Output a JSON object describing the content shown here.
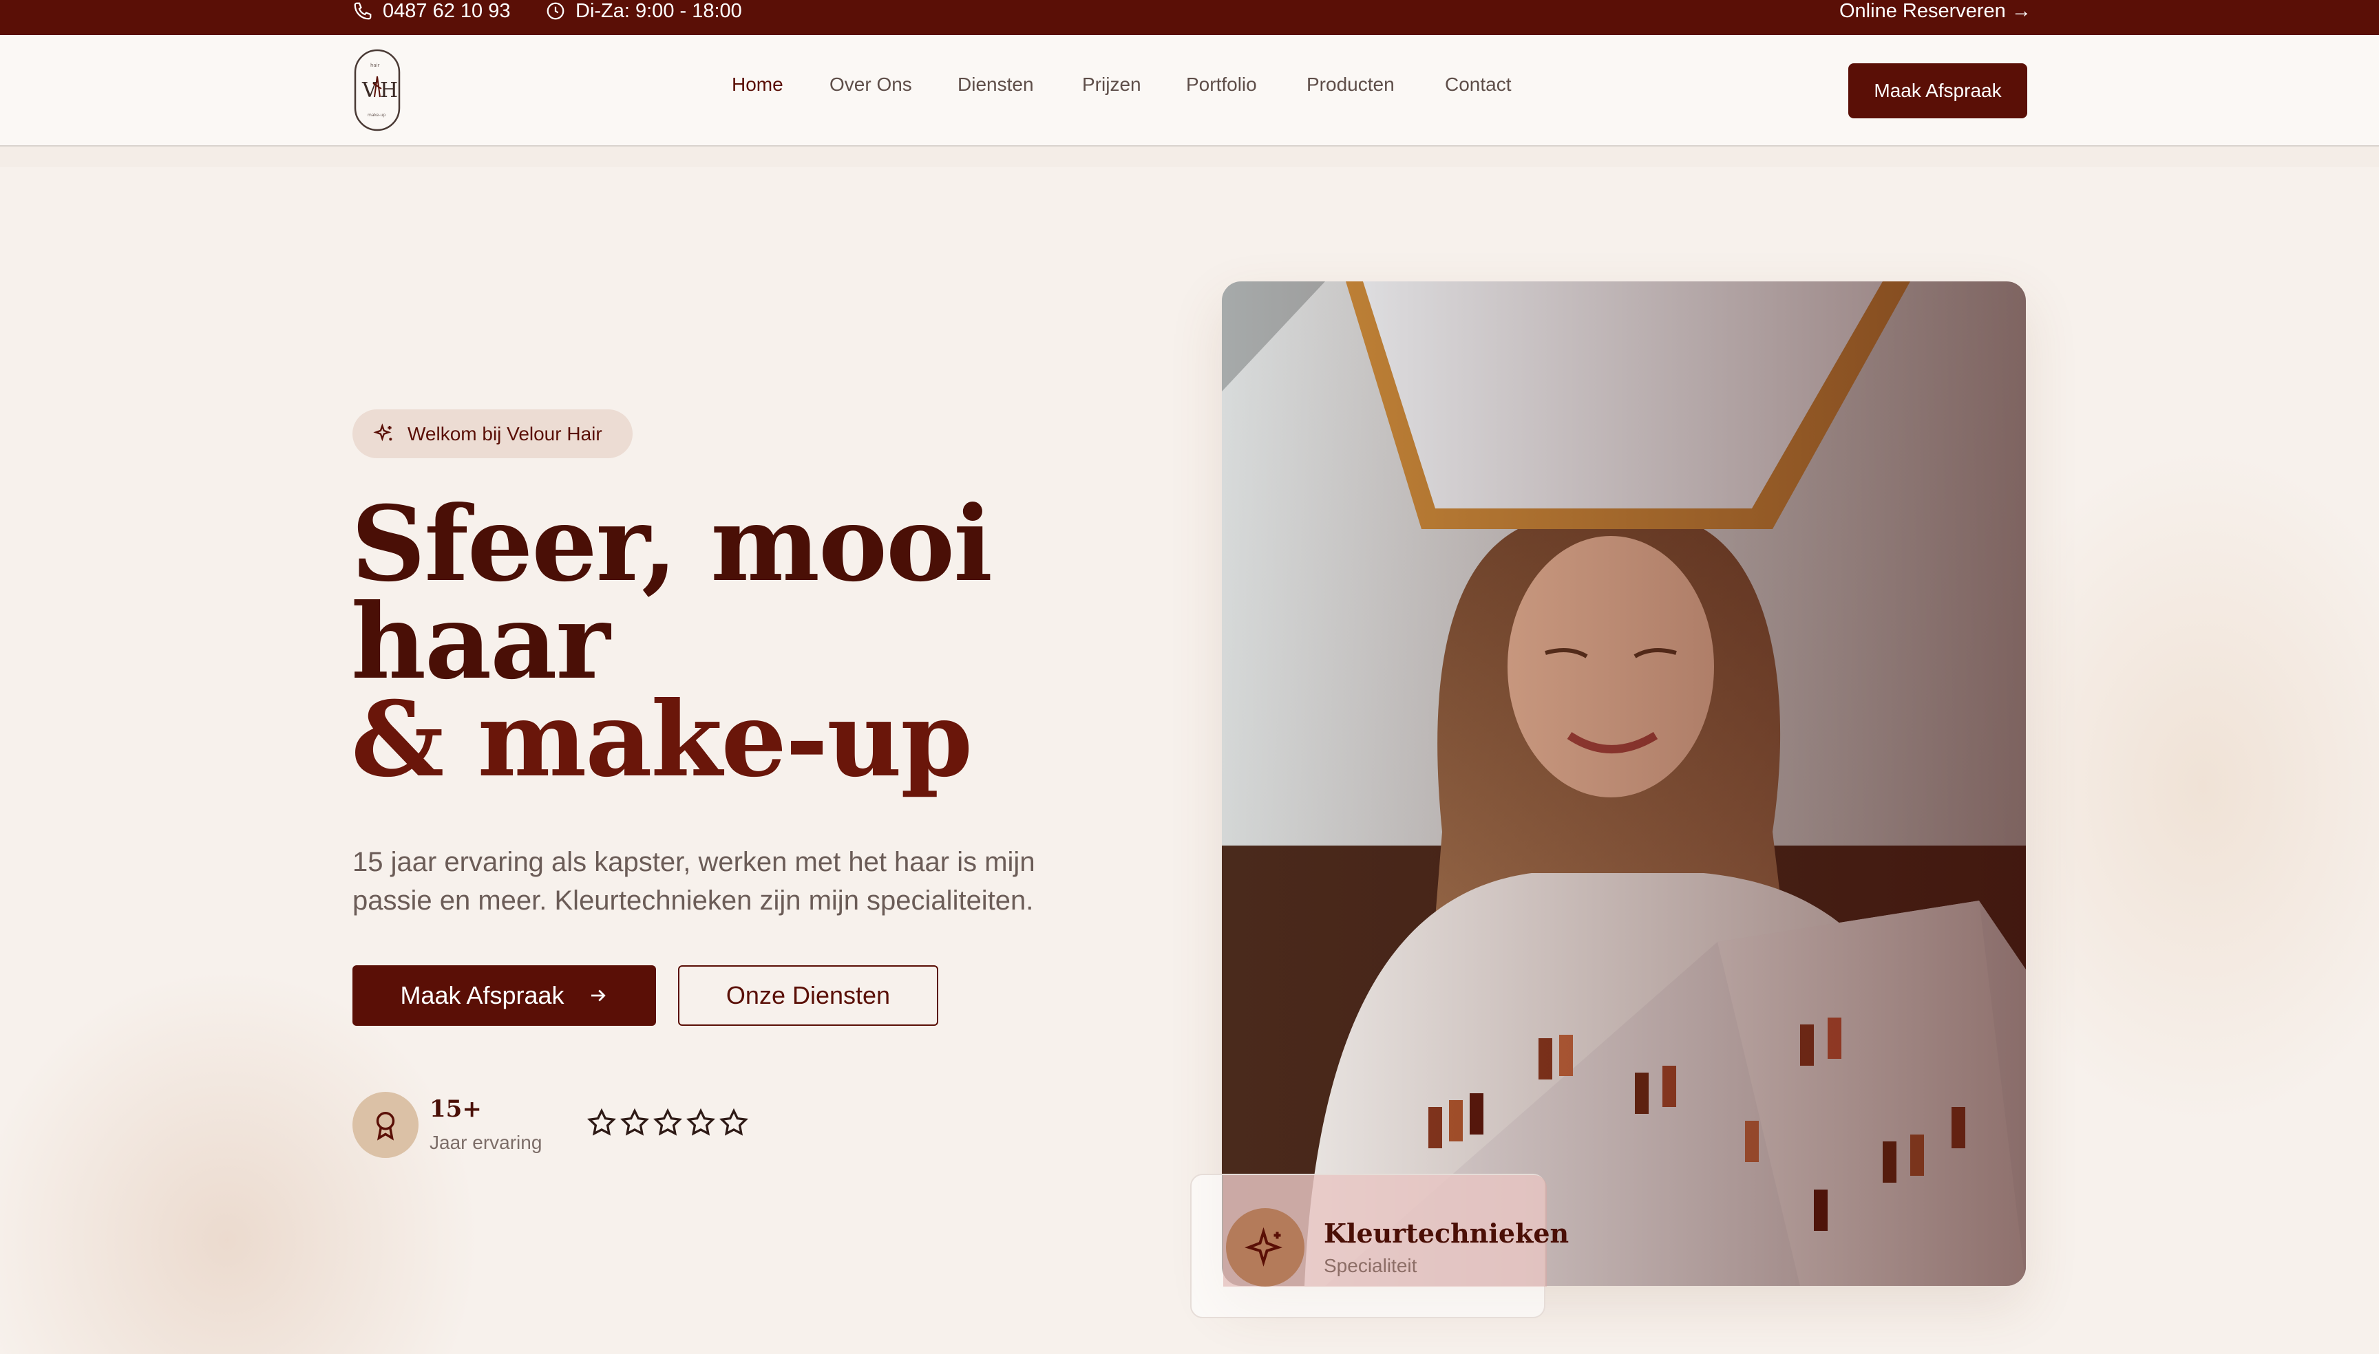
{
  "topbar": {
    "phone": "0487 62 10 93",
    "hours": "Di-Za: 9:00 - 18:00",
    "online_reserve": "Online Reserveren →"
  },
  "header": {
    "nav": [
      "Home",
      "Over Ons",
      "Diensten",
      "Prijzen",
      "Portfolio",
      "Producten",
      "Contact"
    ],
    "active": "Home",
    "cta": "Maak Afspraak"
  },
  "hero": {
    "badge": "Welkom bij Velour Hair",
    "headline_line1": "Sfeer, mooi",
    "headline_line2": "haar",
    "headline_line3": "& make-up",
    "subtext": "15 jaar ervaring als kapster, werken met het haar is mijn passie en meer. Kleurtechnieken zijn mijn specialiteiten.",
    "primary_button": "Maak Afspraak",
    "secondary_button": "Onze Diensten",
    "experience_value": "15+",
    "experience_label": "Jaar ervaring",
    "rating_stars": 5,
    "specialty_title": "Kleurtechnieken",
    "specialty_label": "Specialiteit"
  },
  "colors": {
    "brand": "#5a0f06",
    "background": "#f7f1ec",
    "pill": "#ecdcd3",
    "gold": "#dbc1a6"
  }
}
